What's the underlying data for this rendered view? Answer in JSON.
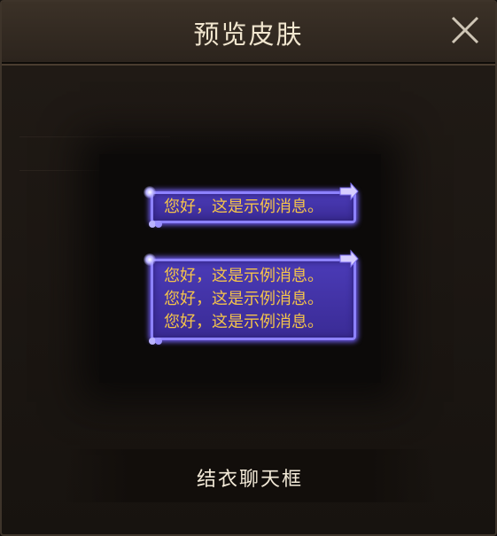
{
  "dialog": {
    "title": "预览皮肤",
    "close_icon": "close-icon"
  },
  "preview": {
    "single_message": "您好，这是示例消息。",
    "multi_message_lines": [
      "您好，这是示例消息。",
      "您好，这是示例消息。",
      "您好，这是示例消息。"
    ]
  },
  "action": {
    "label": "结衣聊天框"
  },
  "colors": {
    "accent_text": "#f5c44a",
    "bubble_fill": "#3f2fa3",
    "bubble_border": "#8d82ff",
    "title_text": "#f1e6cf"
  }
}
